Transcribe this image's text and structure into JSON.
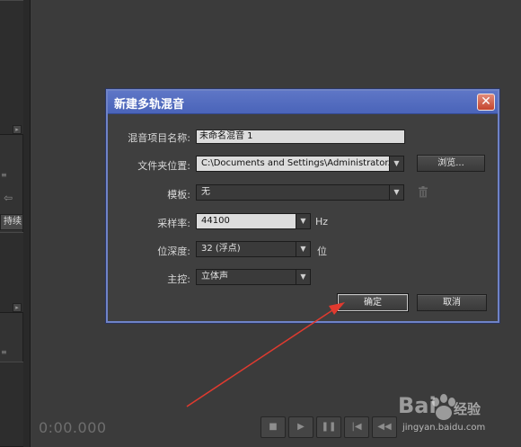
{
  "dialog": {
    "title": "新建多轨混音",
    "close_glyph": "✕",
    "fields": {
      "name_label": "混音项目名称:",
      "name_value": "未命名混音 1",
      "folder_label": "文件夹位置:",
      "folder_value": "C:\\Documents and Settings\\Administrator...",
      "browse_label": "浏览...",
      "template_label": "模板:",
      "template_value": "无",
      "sample_rate_label": "采样率:",
      "sample_rate_value": "44100",
      "sample_rate_unit": "Hz",
      "bit_depth_label": "位深度:",
      "bit_depth_value": "32 (浮点)",
      "bit_depth_unit": "位",
      "master_label": "主控:",
      "master_value": "立体声"
    },
    "buttons": {
      "ok": "确定",
      "cancel": "取消"
    }
  },
  "background": {
    "left_tab_label": "持续",
    "time_display": "0:00.000",
    "transport_icons": [
      "stop-icon",
      "play-icon",
      "pause-icon",
      "go-to-start-icon",
      "rewind-icon"
    ]
  },
  "watermark": {
    "brand": "Bai",
    "jingyan": "经验",
    "url": "jingyan.baidu.com"
  },
  "colors": {
    "accent_titlebar": "#5a72c4",
    "annotation_arrow": "#e03a2f"
  }
}
